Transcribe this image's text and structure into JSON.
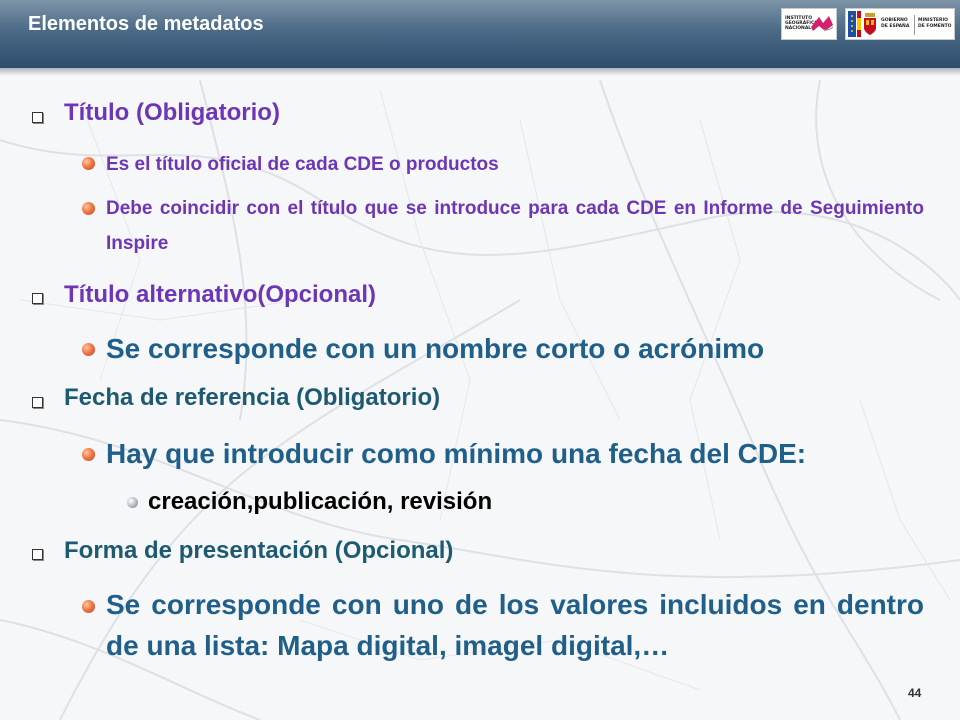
{
  "header": {
    "title": "Elementos de metadatos",
    "logo_ign_lines": [
      "INSTITUTO",
      "GEOGRÁFICO",
      "NACIONAL"
    ],
    "logo_min_left": [
      "GOBIERNO",
      "DE ESPAÑA"
    ],
    "logo_min_right": [
      "MINISTERIO",
      "DE FOMENTO"
    ]
  },
  "items": [
    {
      "level": 1,
      "text": "Título (Obligatorio)"
    },
    {
      "level": 2,
      "text": "Es el título oficial de cada CDE o productos"
    },
    {
      "level": 2,
      "text": "Debe coincidir con el título que se introduce para cada CDE en Informe de Seguimiento Inspire"
    },
    {
      "level": 1,
      "text": "Título alternativo(Opcional)"
    },
    {
      "level": 2,
      "text": "Se corresponde con un nombre corto o acrónimo"
    },
    {
      "level": 1,
      "text": "Fecha de referencia (Obligatorio)"
    },
    {
      "level": 2,
      "text": "Hay que introducir como mínimo una fecha del CDE:"
    },
    {
      "level": 3,
      "text": "creación,publicación, revisión"
    },
    {
      "level": 1,
      "text": "Forma de presentación (Opcional)"
    },
    {
      "level": 2,
      "text": "Se corresponde con uno de los valores incluidos en dentro  de una lista: Mapa digital, imagel digital,…"
    }
  ],
  "page_number": "44",
  "colors": {
    "header_dark": "#2e4d6c",
    "heading_purple": "#6d36b6",
    "heading_teal": "#1d5a72",
    "body_blue": "#1f5f8a"
  }
}
